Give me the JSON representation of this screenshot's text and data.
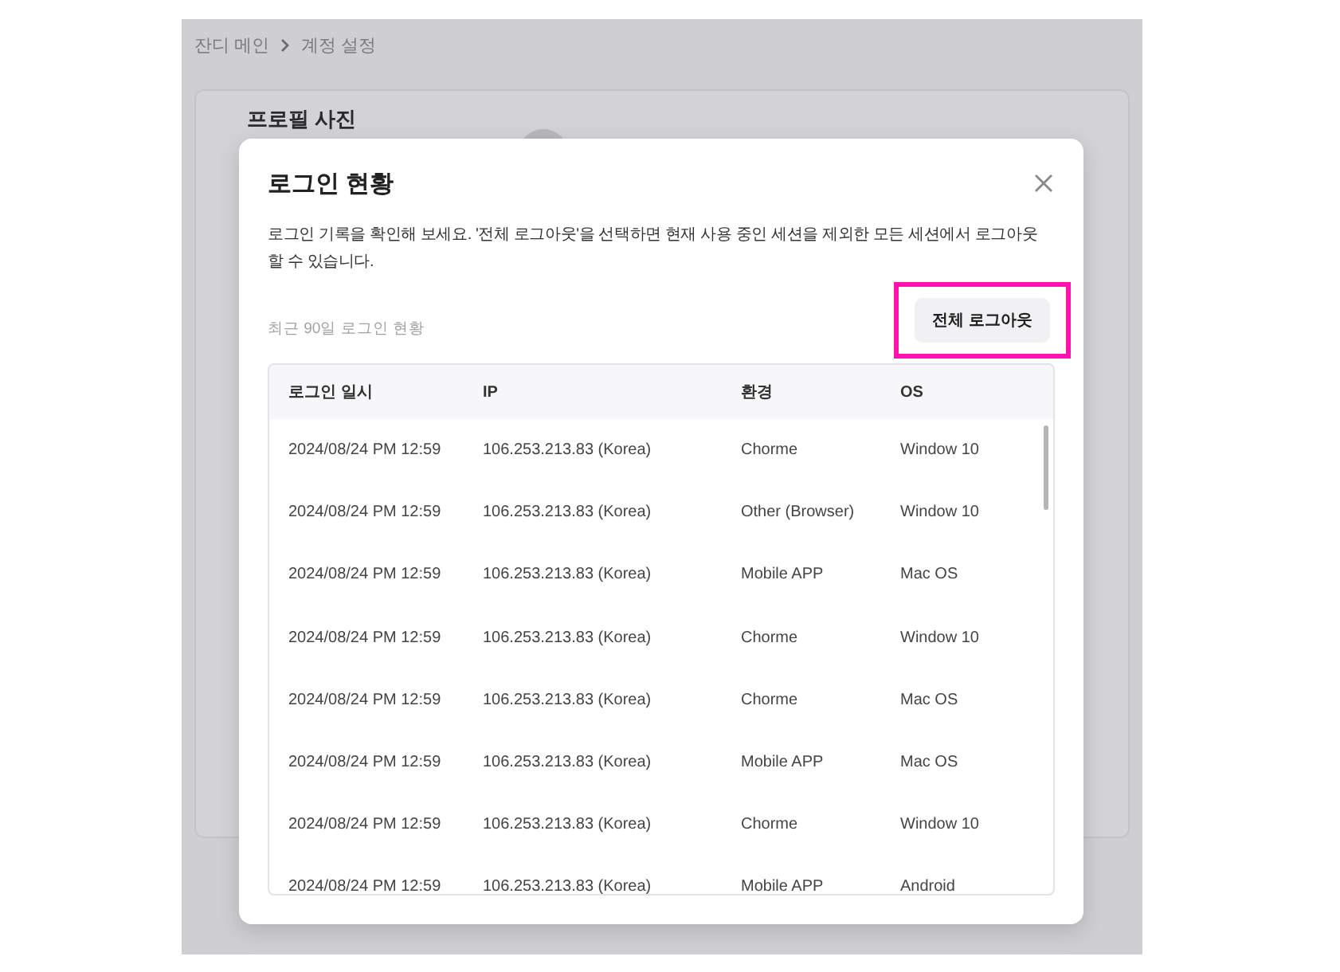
{
  "breadcrumb": [
    {
      "label": "잔디 메인"
    },
    {
      "label": "계정 설정"
    }
  ],
  "profile": {
    "label": "프로필 사진"
  },
  "dialog": {
    "title": "로그인 현황",
    "description": "로그인 기록을 확인해 보세요. '전체 로그아웃'을 선택하면 현재 사용 중인 세션을 제외한 모든 세션에서 로그아웃 할 수 있습니다.",
    "caption": "최근 90일 로그인 현황",
    "logout_button": {
      "label": "전체 로그아웃",
      "highlighted": true
    },
    "table": {
      "columns": [
        "로그인 일시",
        "IP",
        "환경",
        "OS"
      ],
      "rows": [
        [
          "2024/08/24 PM 12:59",
          "106.253.213.83 (Korea)",
          "Chorme",
          "Window 10"
        ],
        [
          "2024/08/24 PM 12:59",
          "106.253.213.83 (Korea)",
          "Other (Browser)",
          "Window 10"
        ],
        [
          "2024/08/24 PM 12:59",
          "106.253.213.83 (Korea)",
          "Mobile APP",
          "Mac OS"
        ],
        [
          "2024/08/24 PM 12:59",
          "106.253.213.83 (Korea)",
          "Chorme",
          "Window 10"
        ],
        [
          "2024/08/24 PM 12:59",
          "106.253.213.83 (Korea)",
          "Chorme",
          "Mac OS"
        ],
        [
          "2024/08/24 PM 12:59",
          "106.253.213.83 (Korea)",
          "Mobile APP",
          "Mac OS"
        ],
        [
          "2024/08/24 PM 12:59",
          "106.253.213.83 (Korea)",
          "Chorme",
          "Window 10"
        ],
        [
          "2024/08/24 PM 12:59",
          "106.253.213.83 (Korea)",
          "Mobile APP",
          "Android"
        ]
      ]
    }
  }
}
